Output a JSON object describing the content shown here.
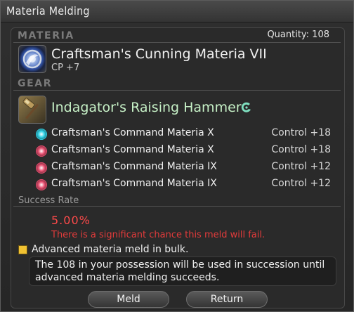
{
  "window": {
    "title": "Materia Melding"
  },
  "materia": {
    "header": "MATERIA",
    "quantity": "Quantity: 108",
    "name": "Craftsman's Cunning Materia VII",
    "stat": "CP +7",
    "icon": "materia-orb-icon"
  },
  "gear": {
    "header": "GEAR",
    "name": "Indagator's Raising Hammer",
    "icon": "hammer-icon",
    "quality_icon": "high-quality-icon",
    "melds": [
      {
        "label": "Craftsman's Command Materia X",
        "stat": "Control +18",
        "color": "#2ad1e6"
      },
      {
        "label": "Craftsman's Command Materia X",
        "stat": "Control +18",
        "color": "#e84a6c"
      },
      {
        "label": "Craftsman's Command Materia IX",
        "stat": "Control +12",
        "color": "#e84a6c"
      },
      {
        "label": "Craftsman's Command Materia IX",
        "stat": "Control +12",
        "color": "#e84a6c"
      }
    ]
  },
  "success": {
    "label": "Success Rate",
    "rate": "5.00%",
    "warning": "There is a significant chance this meld will fail."
  },
  "bulk": {
    "checked": true,
    "label": "Advanced materia meld in bulk.",
    "info": "The 108 in your possession will be used in succession until advanced materia melding succeeds."
  },
  "buttons": {
    "meld": "Meld",
    "return": "Return"
  },
  "colors": {
    "gear_name": "#c6f0c6",
    "rate": "#ff4a4a",
    "warning": "#e33b3b",
    "checkbox": "#f1c232"
  }
}
